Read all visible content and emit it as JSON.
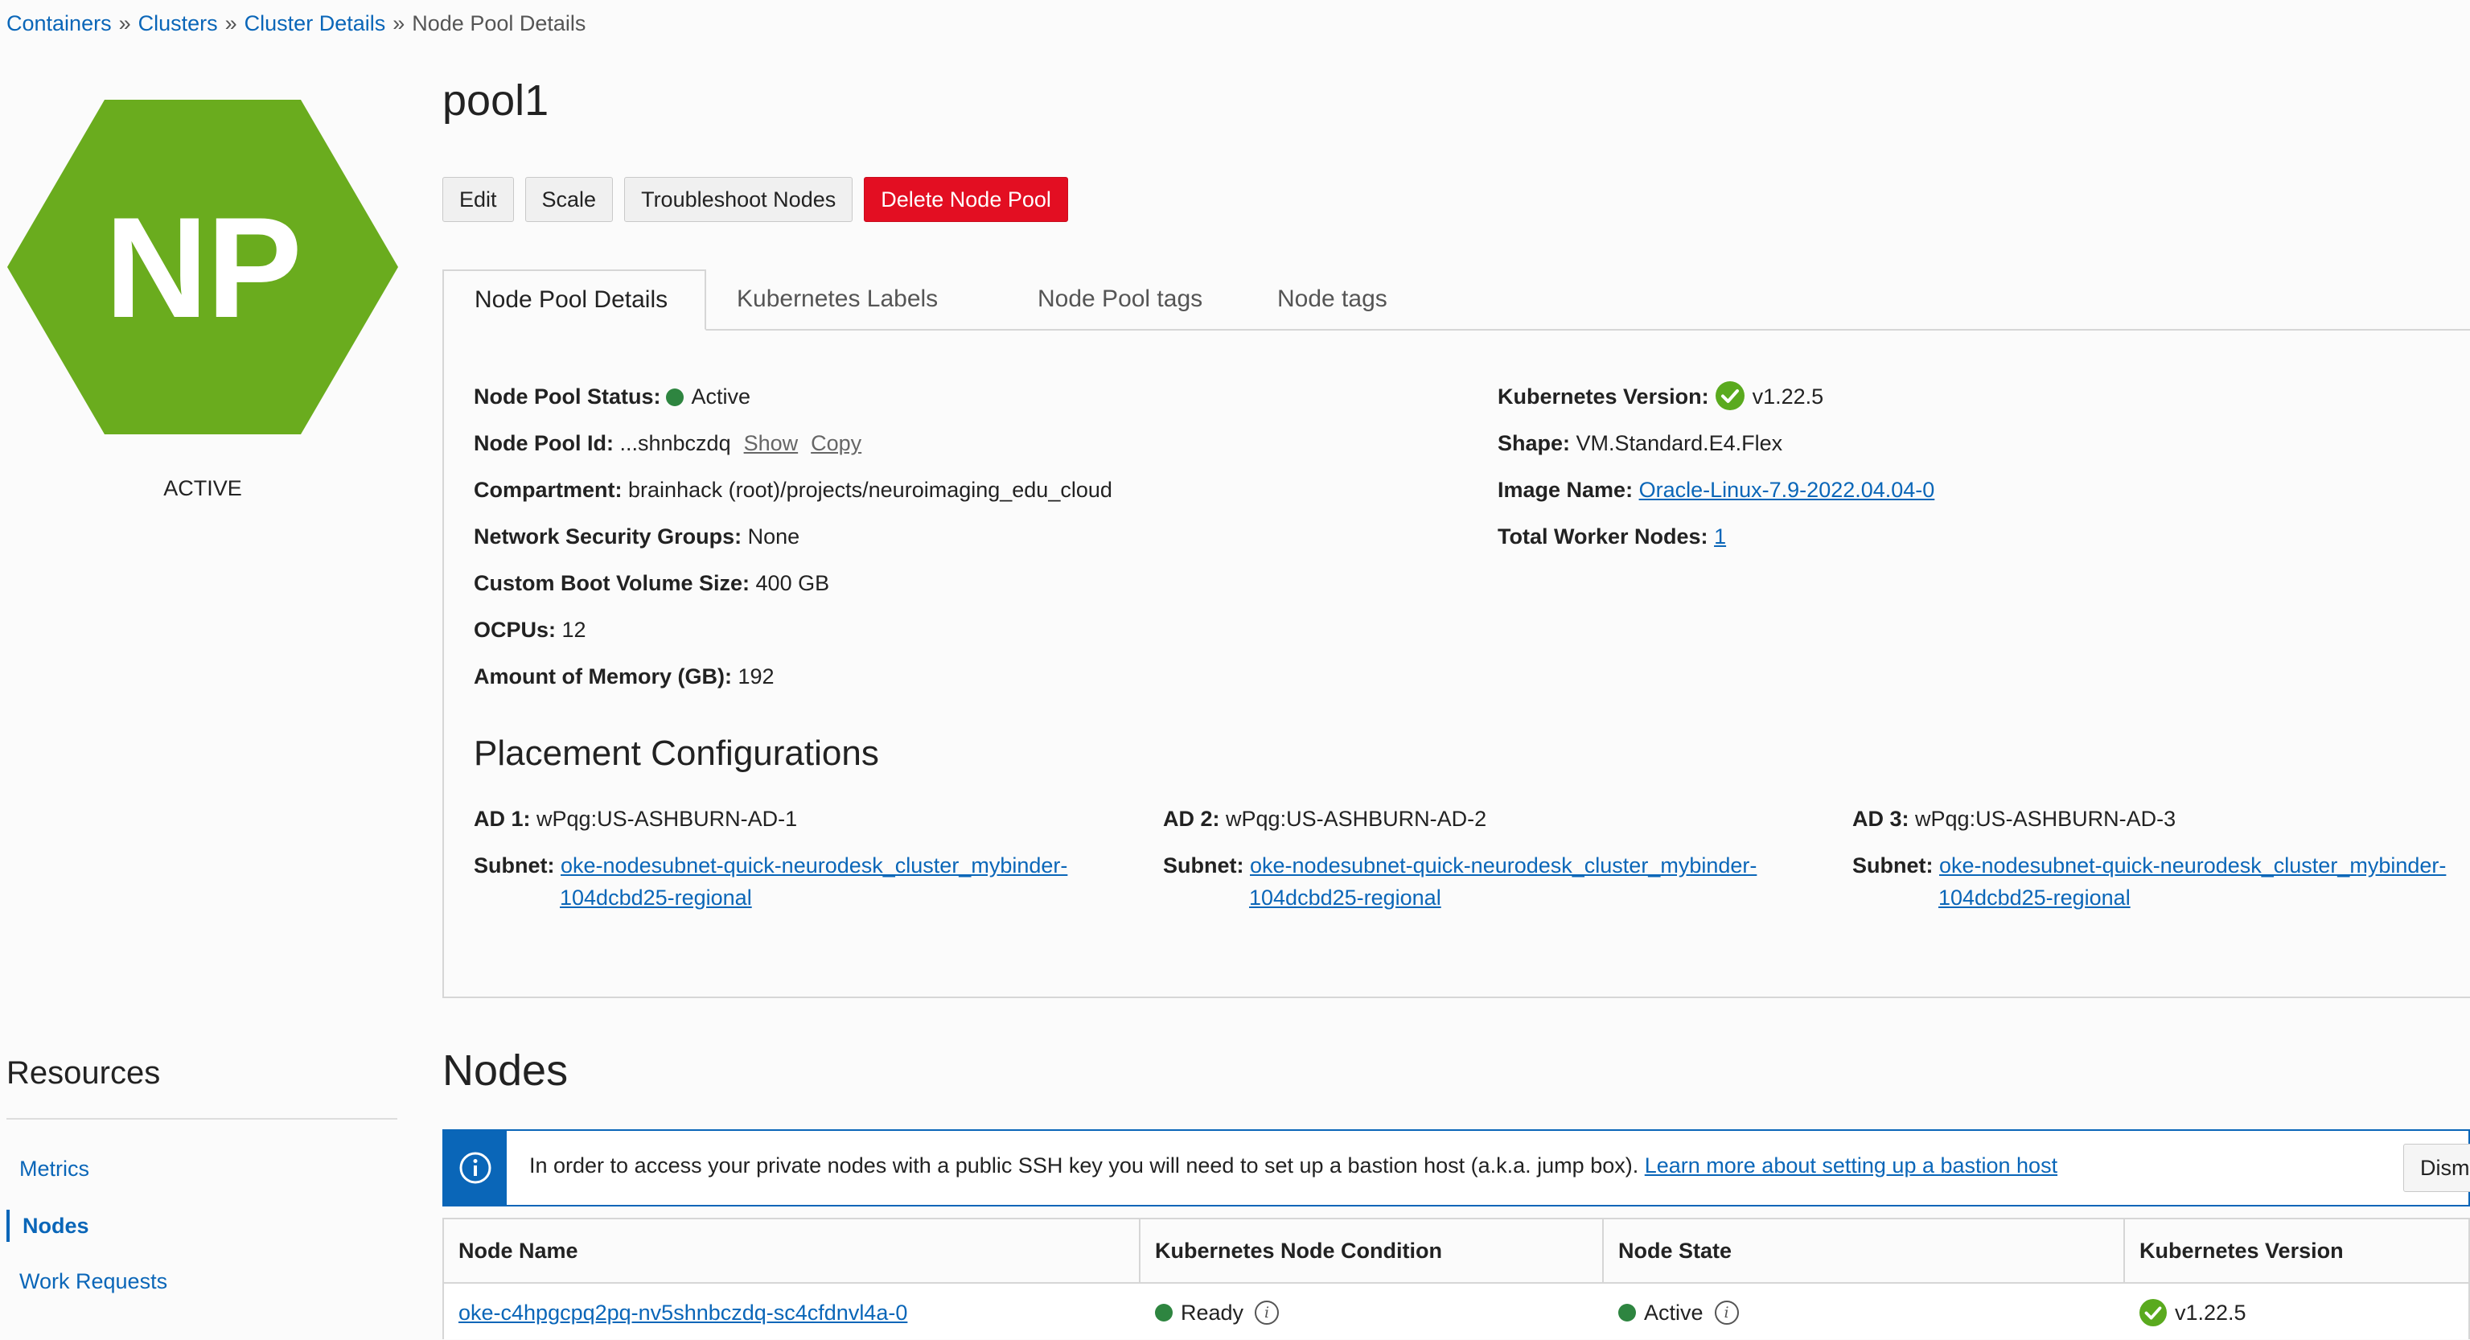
{
  "breadcrumb": {
    "items": [
      "Containers",
      "Clusters",
      "Cluster Details"
    ],
    "current": "Node Pool Details",
    "separator": "»"
  },
  "badge": {
    "initials": "NP",
    "state": "ACTIVE",
    "color": "#6aac1e"
  },
  "page": {
    "title": "pool1"
  },
  "actions": {
    "edit": "Edit",
    "scale": "Scale",
    "troubleshoot": "Troubleshoot Nodes",
    "delete": "Delete Node Pool"
  },
  "tabs": [
    "Node Pool Details",
    "Kubernetes Labels",
    "Node Pool tags",
    "Node tags"
  ],
  "details": {
    "status_label": "Node Pool Status:",
    "status_value": "Active",
    "id_label": "Node Pool Id:",
    "id_value": "...shnbczdq",
    "id_show": "Show",
    "id_copy": "Copy",
    "compartment_label": "Compartment:",
    "compartment_value": "brainhack (root)/projects/neuroimaging_edu_cloud",
    "nsg_label": "Network Security Groups:",
    "nsg_value": "None",
    "boot_label": "Custom Boot Volume Size:",
    "boot_value": "400 GB",
    "ocpu_label": "OCPUs:",
    "ocpu_value": "12",
    "memory_label": "Amount of Memory (GB):",
    "memory_value": "192",
    "k8s_label": "Kubernetes Version:",
    "k8s_value": "v1.22.5",
    "shape_label": "Shape:",
    "shape_value": "VM.Standard.E4.Flex",
    "image_label": "Image Name:",
    "image_value": "Oracle-Linux-7.9-2022.04.04-0",
    "workers_label": "Total Worker Nodes:",
    "workers_value": "1"
  },
  "placement": {
    "title": "Placement Configurations",
    "subnet_label": "Subnet:",
    "ads": [
      {
        "label": "AD 1:",
        "value": "wPqg:US-ASHBURN-AD-1",
        "subnet_line1": "oke-nodesubnet-quick-neurodesk_cluster_mybinder-",
        "subnet_line2": "104dcbd25-regional"
      },
      {
        "label": "AD 2:",
        "value": "wPqg:US-ASHBURN-AD-2",
        "subnet_line1": "oke-nodesubnet-quick-neurodesk_cluster_mybinder-",
        "subnet_line2": "104dcbd25-regional"
      },
      {
        "label": "AD 3:",
        "value": "wPqg:US-ASHBURN-AD-3",
        "subnet_line1": "oke-nodesubnet-quick-neurodesk_cluster_mybinder-",
        "subnet_line2": "104dcbd25-regional"
      }
    ]
  },
  "resources": {
    "title": "Resources",
    "items": [
      "Metrics",
      "Nodes",
      "Work Requests"
    ]
  },
  "nodes": {
    "title": "Nodes",
    "info_text": "In order to access your private nodes with a public SSH key you will need to set up a bastion host (a.k.a. jump box).",
    "info_link": "Learn more about setting up a bastion host",
    "dismiss": "Dism",
    "columns": [
      "Node Name",
      "Kubernetes Node Condition",
      "Node State",
      "Kubernetes Version"
    ],
    "rows": [
      {
        "name": "oke-c4hpgcpq2pq-nv5shnbczdq-sc4cfdnvl4a-0",
        "condition": "Ready",
        "state": "Active",
        "version": "v1.22.5"
      }
    ]
  },
  "colors": {
    "link": "#0a66b8",
    "danger": "#e30e22",
    "success": "#2e8540",
    "check": "#5aaa1e",
    "badge": "#6aac1e"
  },
  "icons": [
    "info-icon",
    "check-icon",
    "status-dot-icon",
    "info-circle-icon"
  ]
}
